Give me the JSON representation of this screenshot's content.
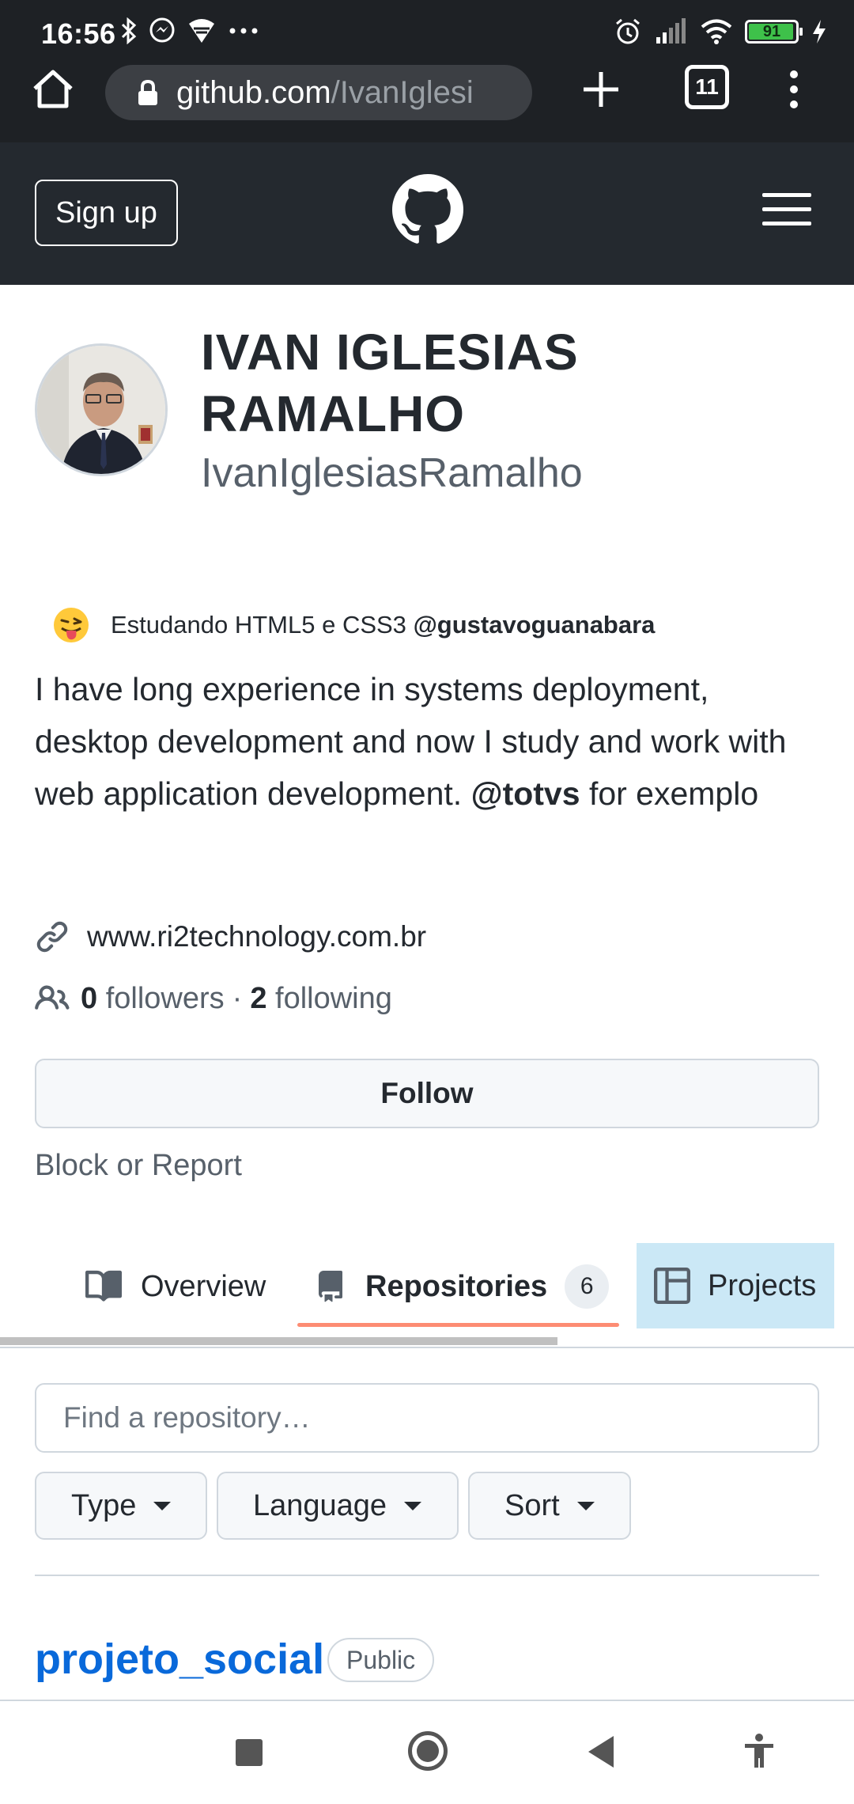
{
  "status_bar": {
    "time": "16:56",
    "battery_level": "91",
    "icons": [
      "bluetooth-icon",
      "messenger-icon",
      "vpn-wifi-icon",
      "more-dots-icon",
      "alarm-icon",
      "signal-icon",
      "wifi-icon",
      "battery-icon",
      "charging-icon"
    ]
  },
  "browser": {
    "url_host": "github.com",
    "url_path": "/IvanIglesi",
    "tab_count": "11"
  },
  "header": {
    "signup_label": "Sign up"
  },
  "profile": {
    "name_line1": "IVAN IGLESIAS",
    "name_line2": "RAMALHO",
    "username": "IvanIglesiasRamalho",
    "status_text": "Estudando HTML5 e CSS3",
    "status_mention": "@gustavoguanabara",
    "bio_prefix": "I have long experience in systems deployment, desktop development and now I study and work with web application development.",
    "bio_mention": "@totvs",
    "bio_suffix": "for exemplo",
    "website": "www.ri2technology.com.br",
    "followers_count": "0",
    "followers_label": "followers",
    "separator": "·",
    "following_count": "2",
    "following_label": "following",
    "follow_button": "Follow",
    "block_report": "Block or Report"
  },
  "tabs": {
    "overview": "Overview",
    "repositories": "Repositories",
    "repositories_count": "6",
    "projects": "Projects"
  },
  "repo_filters": {
    "search_placeholder": "Find a repository…",
    "type_label": "Type",
    "language_label": "Language",
    "sort_label": "Sort"
  },
  "repos": [
    {
      "name": "projeto_social",
      "visibility": "Public"
    }
  ]
}
